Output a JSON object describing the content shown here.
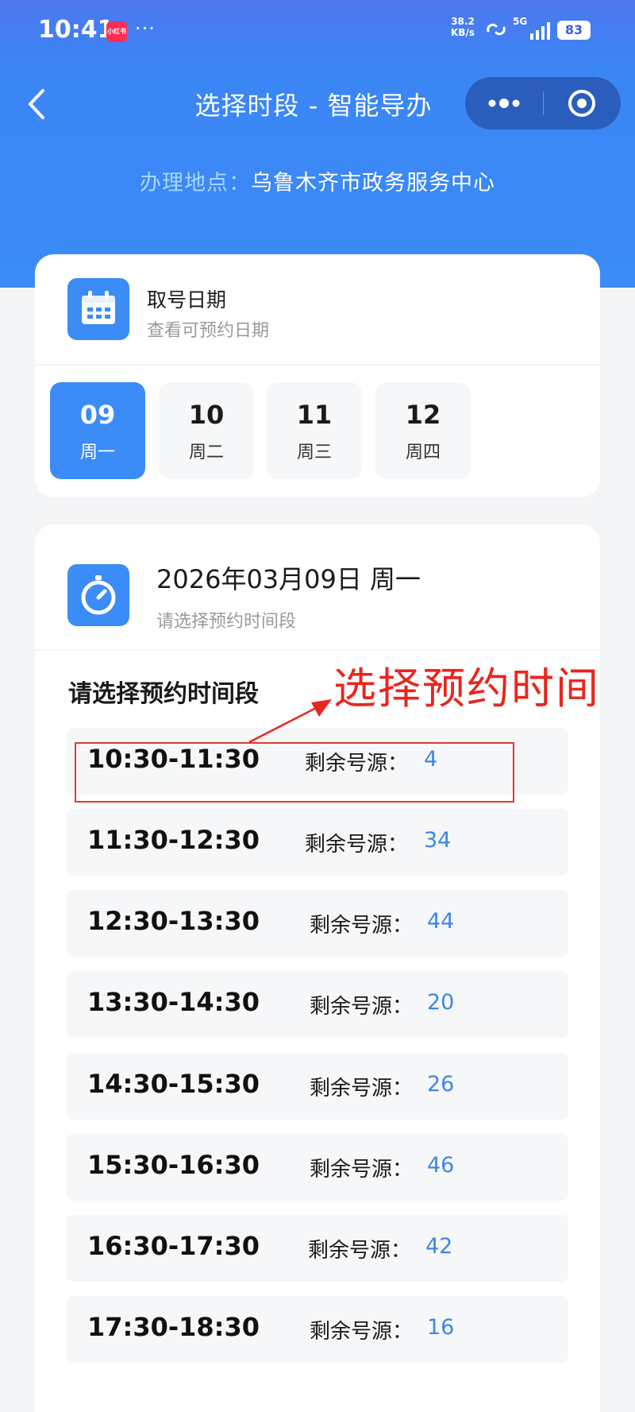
{
  "status_bar": {
    "time": "10:41",
    "app_badge": "小红书",
    "more": "···",
    "net_speed": "38.2",
    "net_unit": "KB/s",
    "network": "5G",
    "battery": "83"
  },
  "nav": {
    "title": "选择时段 - 智能导办"
  },
  "location": {
    "label": "办理地点：",
    "value": "乌鲁木齐市政务服务中心"
  },
  "date_card": {
    "title": "取号日期",
    "subtitle": "查看可预约日期",
    "dates": [
      {
        "day": "09",
        "weekday": "周一",
        "selected": true
      },
      {
        "day": "10",
        "weekday": "周二",
        "selected": false
      },
      {
        "day": "11",
        "weekday": "周三",
        "selected": false
      },
      {
        "day": "12",
        "weekday": "周四",
        "selected": false
      }
    ]
  },
  "slot_card": {
    "date_heading": "2026年03月09日 周一",
    "subtitle": "请选择预约时间段",
    "section_label": "请选择预约时间段",
    "remaining_label": "剩余号源：",
    "slots": [
      {
        "time": "10:30-11:30",
        "count": "4"
      },
      {
        "time": "11:30-12:30",
        "count": "34"
      },
      {
        "time": "12:30-13:30",
        "count": "44"
      },
      {
        "time": "13:30-14:30",
        "count": "20"
      },
      {
        "time": "14:30-15:30",
        "count": "26"
      },
      {
        "time": "15:30-16:30",
        "count": "46"
      },
      {
        "time": "16:30-17:30",
        "count": "42"
      },
      {
        "time": "17:30-18:30",
        "count": "16"
      }
    ]
  },
  "annotation": {
    "text": "选择预约时间"
  },
  "colors": {
    "primary": "#3b8cf7",
    "count_text": "#3d86e6",
    "annotation": "#e8261f"
  }
}
